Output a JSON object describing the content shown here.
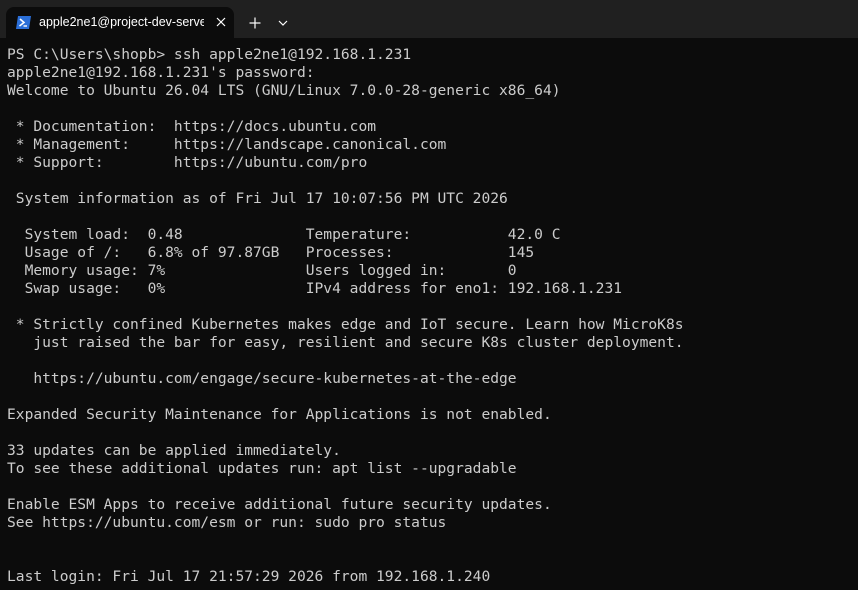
{
  "tab": {
    "title": "apple2ne1@project-dev-serve",
    "icon": "powershell-icon"
  },
  "toolbar": {
    "new_tab_icon": "plus-icon",
    "dropdown_icon": "chevron-down-icon",
    "close_icon": "close-icon"
  },
  "colors": {
    "background": "#0c0c0c",
    "titlebar": "#202020",
    "text": "#cccccc",
    "powershell_blue": "#2b6fd8"
  },
  "terminal": {
    "lines": [
      "PS C:\\Users\\shopb> ssh apple2ne1@192.168.1.231",
      "apple2ne1@192.168.1.231's password:",
      "Welcome to Ubuntu 26.04 LTS (GNU/Linux 7.0.0-28-generic x86_64)",
      "",
      " * Documentation:  https://docs.ubuntu.com",
      " * Management:     https://landscape.canonical.com",
      " * Support:        https://ubuntu.com/pro",
      "",
      " System information as of Fri Jul 17 10:07:56 PM UTC 2026",
      "",
      "  System load:  0.48              Temperature:           42.0 C",
      "  Usage of /:   6.8% of 97.87GB   Processes:             145",
      "  Memory usage: 7%                Users logged in:       0",
      "  Swap usage:   0%                IPv4 address for eno1: 192.168.1.231",
      "",
      " * Strictly confined Kubernetes makes edge and IoT secure. Learn how MicroK8s",
      "   just raised the bar for easy, resilient and secure K8s cluster deployment.",
      "",
      "   https://ubuntu.com/engage/secure-kubernetes-at-the-edge",
      "",
      "Expanded Security Maintenance for Applications is not enabled.",
      "",
      "33 updates can be applied immediately.",
      "To see these additional updates run: apt list --upgradable",
      "",
      "Enable ESM Apps to receive additional future security updates.",
      "See https://ubuntu.com/esm or run: sudo pro status",
      "",
      "",
      "Last login: Fri Jul 17 21:57:29 2026 from 192.168.1.240"
    ]
  }
}
